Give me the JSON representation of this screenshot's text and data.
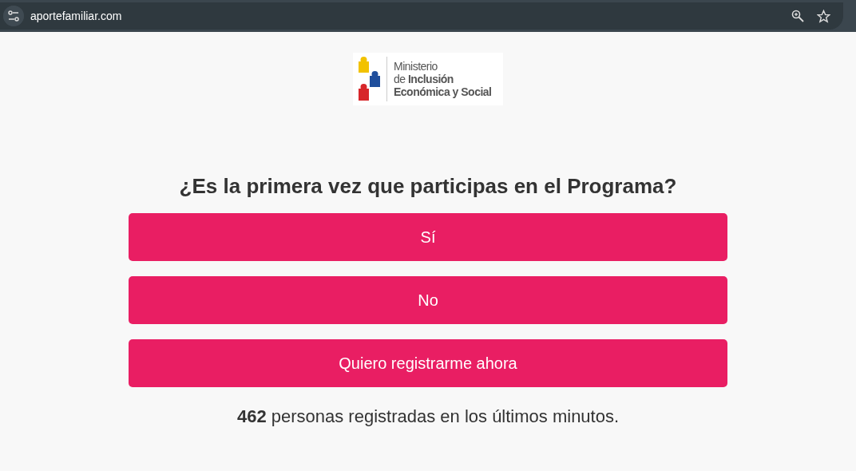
{
  "browser": {
    "url": "aportefamiliar.com"
  },
  "logo": {
    "lines": [
      "Ministerio",
      "de **Inclusión**",
      "**Económica y Social**"
    ]
  },
  "question": "¿Es la primera vez que participas en el Programa?",
  "buttons": [
    "Sí",
    "No",
    "Quiero registrarme ahora"
  ],
  "footer": "**462** personas registradas en los últimos minutos."
}
